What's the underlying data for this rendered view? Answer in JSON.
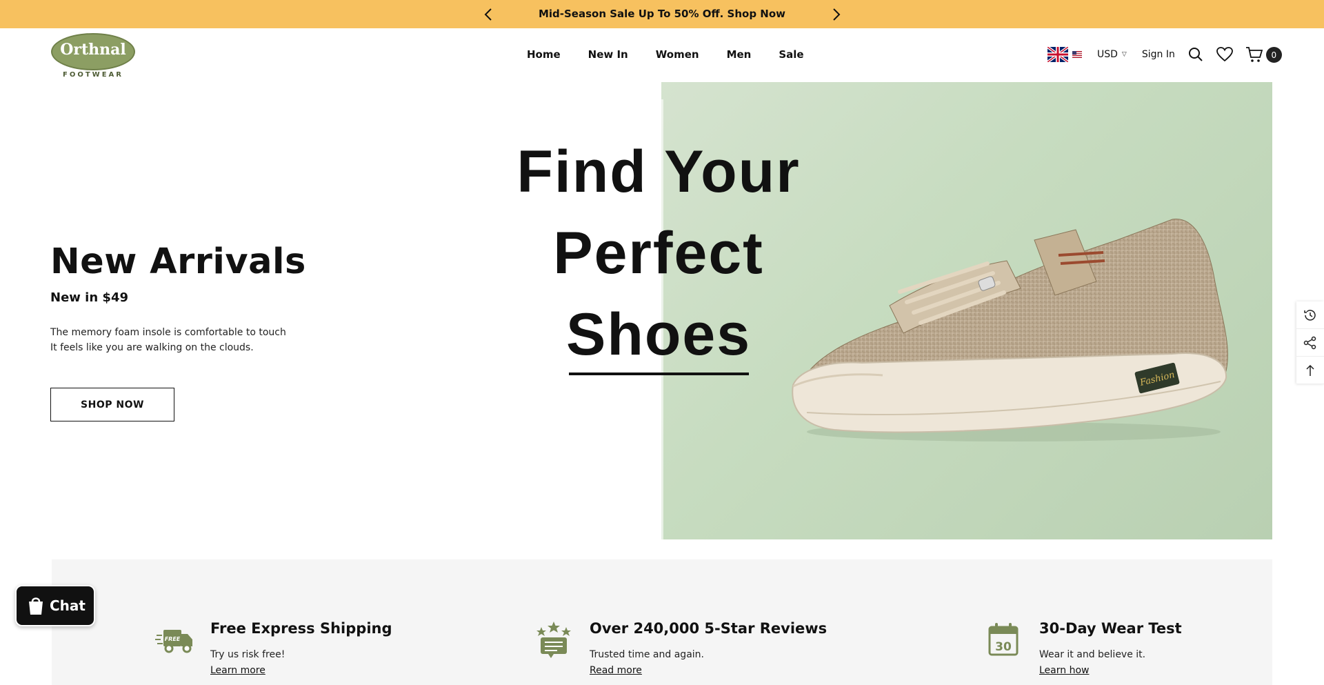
{
  "announcement": {
    "text": "Mid-Season Sale Up To 50% Off. Shop Now"
  },
  "logo": {
    "name": "Orthnal",
    "tagline": "FOOTWEAR"
  },
  "nav": {
    "items": [
      "Home",
      "New In",
      "Women",
      "Men",
      "Sale"
    ]
  },
  "utils": {
    "currency": "USD",
    "sign_in": "Sign In",
    "cart_count": "0"
  },
  "hero": {
    "headline_lines": [
      "Find Your",
      "Perfect",
      "Shoes"
    ],
    "title": "New Arrivals",
    "subtitle": "New in $49",
    "desc_line1": "The memory foam insole is comfortable to touch",
    "desc_line2": "It feels like you are walking on the clouds.",
    "cta": "SHOP NOW",
    "badge_text": "Fashion"
  },
  "features": [
    {
      "title": "Free Express Shipping",
      "desc": "Try us risk free!",
      "link": "Learn more",
      "icon": "truck-icon",
      "icon_text": "FREE"
    },
    {
      "title": "Over 240,000 5-Star Reviews",
      "desc": "Trusted time and again.",
      "link": "Read more",
      "icon": "review-stars-icon"
    },
    {
      "title": "30-Day Wear Test",
      "desc": "Wear it and believe it.",
      "link": "Learn how",
      "icon": "calendar-icon",
      "icon_text": "30"
    }
  ],
  "chat": {
    "label": "Chat"
  },
  "colors": {
    "announcement_bg": "#f7c15f",
    "logo_green": "#8c9e63",
    "hero_bg": "#c7dcc0",
    "features_bg": "#f5f5f5"
  }
}
